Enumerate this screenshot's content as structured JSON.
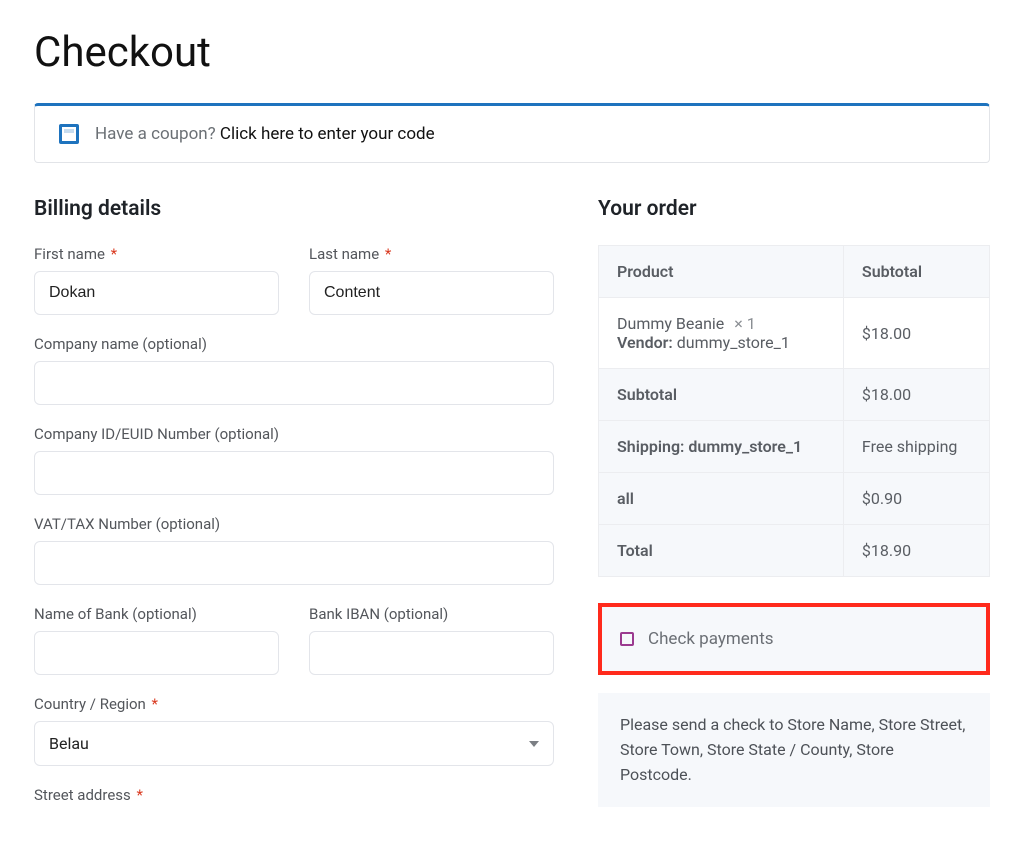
{
  "page": {
    "title": "Checkout"
  },
  "coupon": {
    "prompt": "Have a coupon? ",
    "link": "Click here to enter your code"
  },
  "billing": {
    "heading": "Billing details",
    "first_name": {
      "label": "First name",
      "value": "Dokan",
      "required": true
    },
    "last_name": {
      "label": "Last name",
      "value": "Content",
      "required": true
    },
    "company_name": {
      "label": "Company name (optional)",
      "value": ""
    },
    "company_id": {
      "label": "Company ID/EUID Number (optional)",
      "value": ""
    },
    "vat": {
      "label": "VAT/TAX Number (optional)",
      "value": ""
    },
    "bank_name": {
      "label": "Name of Bank (optional)",
      "value": ""
    },
    "bank_iban": {
      "label": "Bank IBAN (optional)",
      "value": ""
    },
    "country": {
      "label": "Country / Region",
      "value": "Belau",
      "required": true
    },
    "street": {
      "label": "Street address",
      "required": true
    }
  },
  "order": {
    "heading": "Your order",
    "columns": {
      "product": "Product",
      "subtotal": "Subtotal"
    },
    "item": {
      "name": "Dummy Beanie",
      "qty": "× 1",
      "vendor_label": "Vendor:",
      "vendor_value": "dummy_store_1",
      "price": "$18.00"
    },
    "subtotal": {
      "label": "Subtotal",
      "value": "$18.00"
    },
    "shipping": {
      "label": "Shipping: dummy_store_1",
      "value": "Free shipping"
    },
    "all": {
      "label": "all",
      "value": "$0.90"
    },
    "total": {
      "label": "Total",
      "value": "$18.90"
    }
  },
  "payment": {
    "method_label": "Check payments",
    "description": "Please send a check to Store Name, Store Street, Store Town, Store State / County, Store Postcode."
  }
}
